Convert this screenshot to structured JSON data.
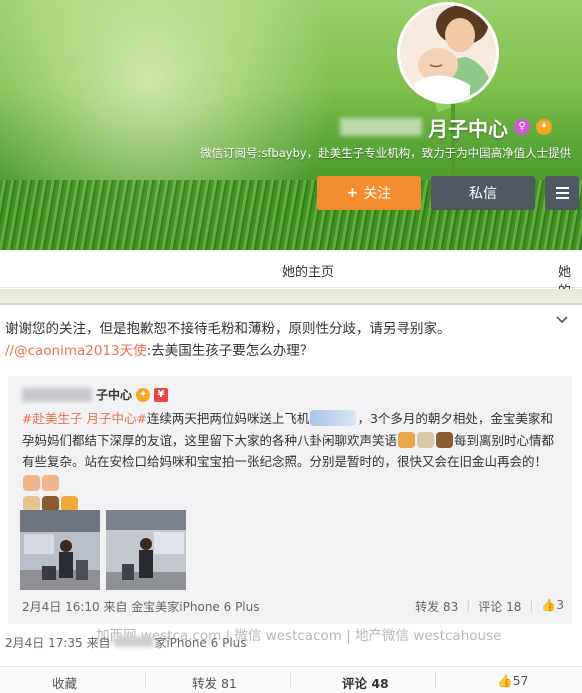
{
  "profile": {
    "name_suffix": "月子中心",
    "description": "微信订阅号:sfbayby，赴美生子专业机构，致力于为中国高净值人士提供",
    "colors": {
      "follow": "#f28c2e",
      "dark_button": "#505863",
      "link": "#eb7350"
    }
  },
  "buttons": {
    "follow_icon": "plus-icon",
    "follow_label": "关注",
    "message_label": "私信",
    "menu_icon": "hamburger-icon"
  },
  "nav": {
    "tabs": [
      "她的主页",
      "她的"
    ]
  },
  "post": {
    "text_line1": "谢谢您的关注，但是抱歉恕不接待毛粉和薄粉，原则性分歧，请另寻别家。",
    "mention": "//@caonima2013天使",
    "text_line2_rest": ":去美国生孩子要怎么办理？",
    "repost": {
      "author_suffix": "子中心",
      "tag": "#赴美生子 月子中心#",
      "body_a": "连续两天把两位妈咪送上飞机",
      "body_b": "，3个多月的朝夕相处，金宝美家和孕妈妈们都结下深厚的友谊，这里留下大家的各种八卦闲聊欢声笑语",
      "body_c": "每到离别时心情都有些复杂。站在安检口给妈咪和宝宝拍一张纪念照。分别是暂时的，很快又会在旧金山再会的！",
      "time_source": "2月4日 16:10 来自 金宝美家iPhone 6 Plus",
      "forward": "转发 83",
      "comment": "评论 18",
      "like": "3"
    },
    "meta_time": "2月4日 17:35 来自",
    "meta_source": "家iPhone 6 Plus",
    "watermark": "加西网 westca.com | 微信 westcacom | 地产微信 westcahouse"
  },
  "actions": {
    "collect": "收藏",
    "forward": "转发 81",
    "comment": "评论 48",
    "like": "57"
  }
}
